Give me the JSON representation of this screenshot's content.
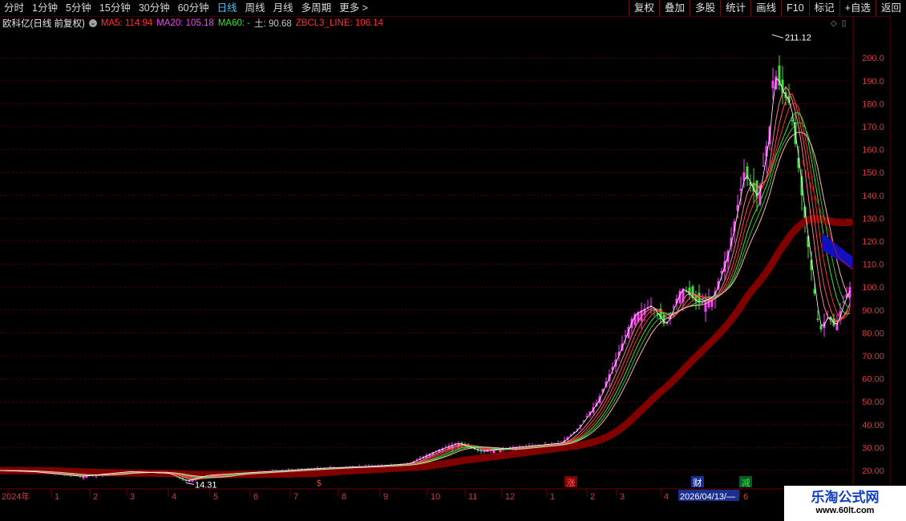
{
  "toolbar": {
    "periods": [
      "分时",
      "1分钟",
      "5分钟",
      "15分钟",
      "30分钟",
      "60分钟",
      "日线",
      "周线",
      "月线",
      "多周期",
      "更多 >"
    ],
    "active_period": "日线",
    "right_buttons": [
      "复权",
      "叠加",
      "多股",
      "统计",
      "画线",
      "F10",
      "标记",
      "+自选",
      "返回"
    ]
  },
  "info": {
    "title": "欧科亿(日线 前复权)",
    "ma5": "MA5: 114.94",
    "ma20": "MA20: 105.18",
    "ma60": "MA60: -",
    "earth": "土: 90.68",
    "zbcl": "ZBCL3_LINE: 106.14"
  },
  "colors": {
    "ma5": "#ff3030",
    "ma20": "#ff40ff",
    "ma60": "#40e040",
    "earth": "#c8c8c8",
    "zbcl": "#ff3030",
    "up": "#ff40ff",
    "down": "#40e040",
    "thick": "#800000",
    "blue": "#1010c0"
  },
  "y_axis": [
    "200.0",
    "190.0",
    "180.0",
    "170.0",
    "160.0",
    "150.0",
    "140.0",
    "130.0",
    "120.0",
    "110.0",
    "100.0",
    "90.00",
    "80.00",
    "70.00",
    "60.00",
    "50.00",
    "40.00",
    "30.00",
    "20.00"
  ],
  "annotations": {
    "high": "211.12",
    "low": "14.31"
  },
  "x_axis": [
    "2024年",
    "1",
    "2",
    "3",
    "4",
    "5",
    "6",
    "7",
    "8",
    "9",
    "10",
    "11",
    "12",
    "1",
    "2",
    "3",
    "4",
    "2026/04/13/—",
    "6"
  ],
  "markers": [
    "$",
    "涨",
    "财",
    "减"
  ],
  "watermark": {
    "title": "乐淘公式网",
    "url": "www.60lt.com"
  }
}
